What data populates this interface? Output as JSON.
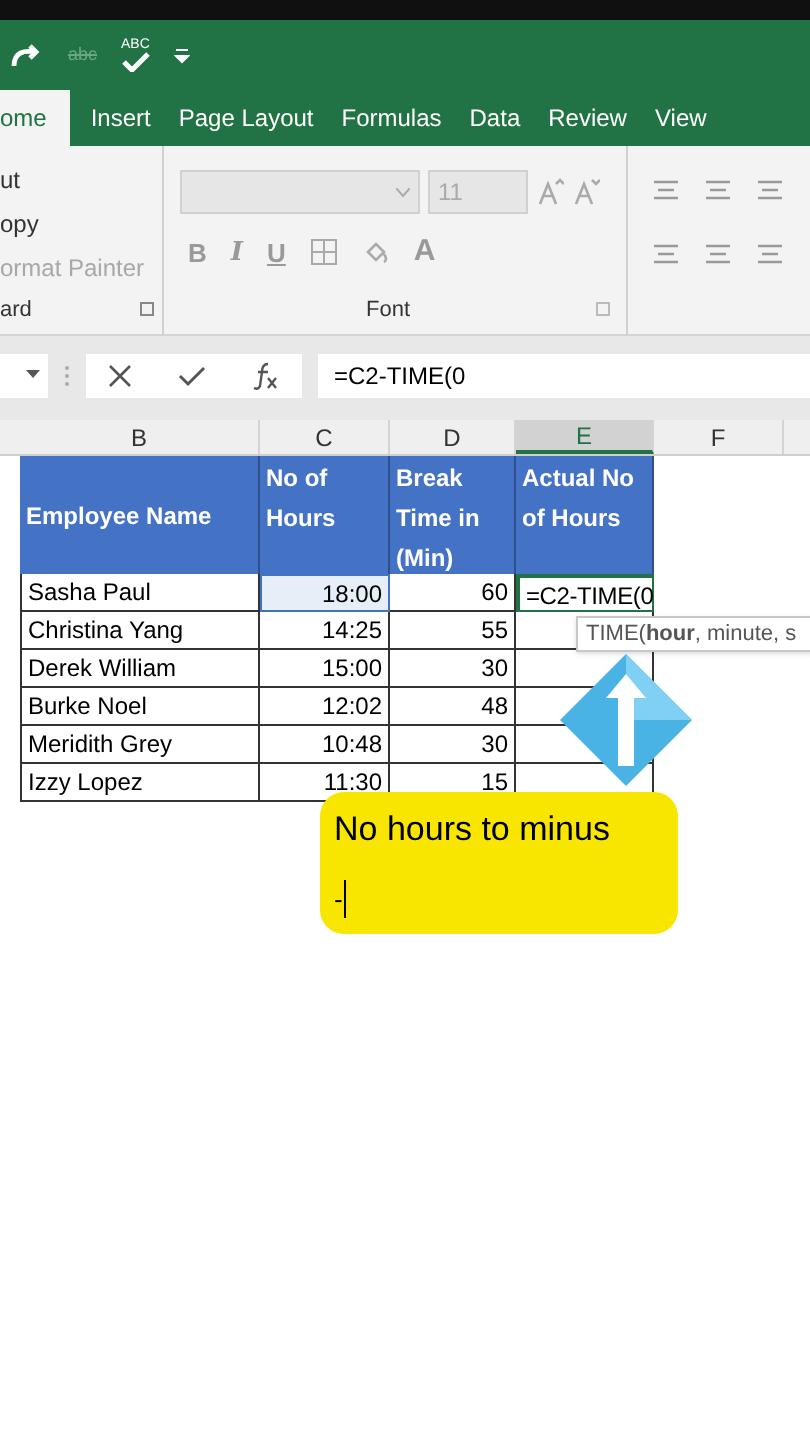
{
  "quick_access": {
    "strike_label": "abc",
    "spell_label": "ABC"
  },
  "tabs": [
    {
      "label": "ome",
      "selected": true
    },
    {
      "label": "Insert",
      "selected": false
    },
    {
      "label": "Page Layout",
      "selected": false
    },
    {
      "label": "Formulas",
      "selected": false
    },
    {
      "label": "Data",
      "selected": false
    },
    {
      "label": "Review",
      "selected": false
    },
    {
      "label": "View",
      "selected": false
    }
  ],
  "clipboard": {
    "items": [
      {
        "label": "ut",
        "disabled": false
      },
      {
        "label": "opy",
        "disabled": false
      },
      {
        "label": "ormat Painter",
        "disabled": true
      }
    ],
    "group_label": "ard"
  },
  "font_group": {
    "font_size": "11",
    "bold": "B",
    "italic": "I",
    "underline": "U",
    "font_color": "A",
    "group_label": "Font"
  },
  "formula_bar": {
    "formula": "=C2-TIME(0"
  },
  "columns": [
    {
      "label": "B",
      "selected": false
    },
    {
      "label": "C",
      "selected": false
    },
    {
      "label": "D",
      "selected": false
    },
    {
      "label": "E",
      "selected": true
    },
    {
      "label": "F",
      "selected": false
    }
  ],
  "table": {
    "headers": [
      "Employee Name",
      "No of Hours",
      "Break Time in (Min)",
      "Actual No of Hours"
    ],
    "rows": [
      {
        "name": "Sasha Paul",
        "hours": "18:00",
        "break": "60",
        "actual": "=C2-TIME(0"
      },
      {
        "name": "Christina Yang",
        "hours": "14:25",
        "break": "55",
        "actual": ""
      },
      {
        "name": "Derek William",
        "hours": "15:00",
        "break": "30",
        "actual": ""
      },
      {
        "name": "Burke Noel",
        "hours": "12:02",
        "break": "48",
        "actual": ""
      },
      {
        "name": "Meridith Grey",
        "hours": "10:48",
        "break": "30",
        "actual": ""
      },
      {
        "name": "Izzy Lopez",
        "hours": "11:30",
        "break": "15",
        "actual": ""
      }
    ]
  },
  "tooltip": "TIME(**hour**, minute, s",
  "callout": {
    "title": "No hours to minus",
    "typed": "-"
  }
}
